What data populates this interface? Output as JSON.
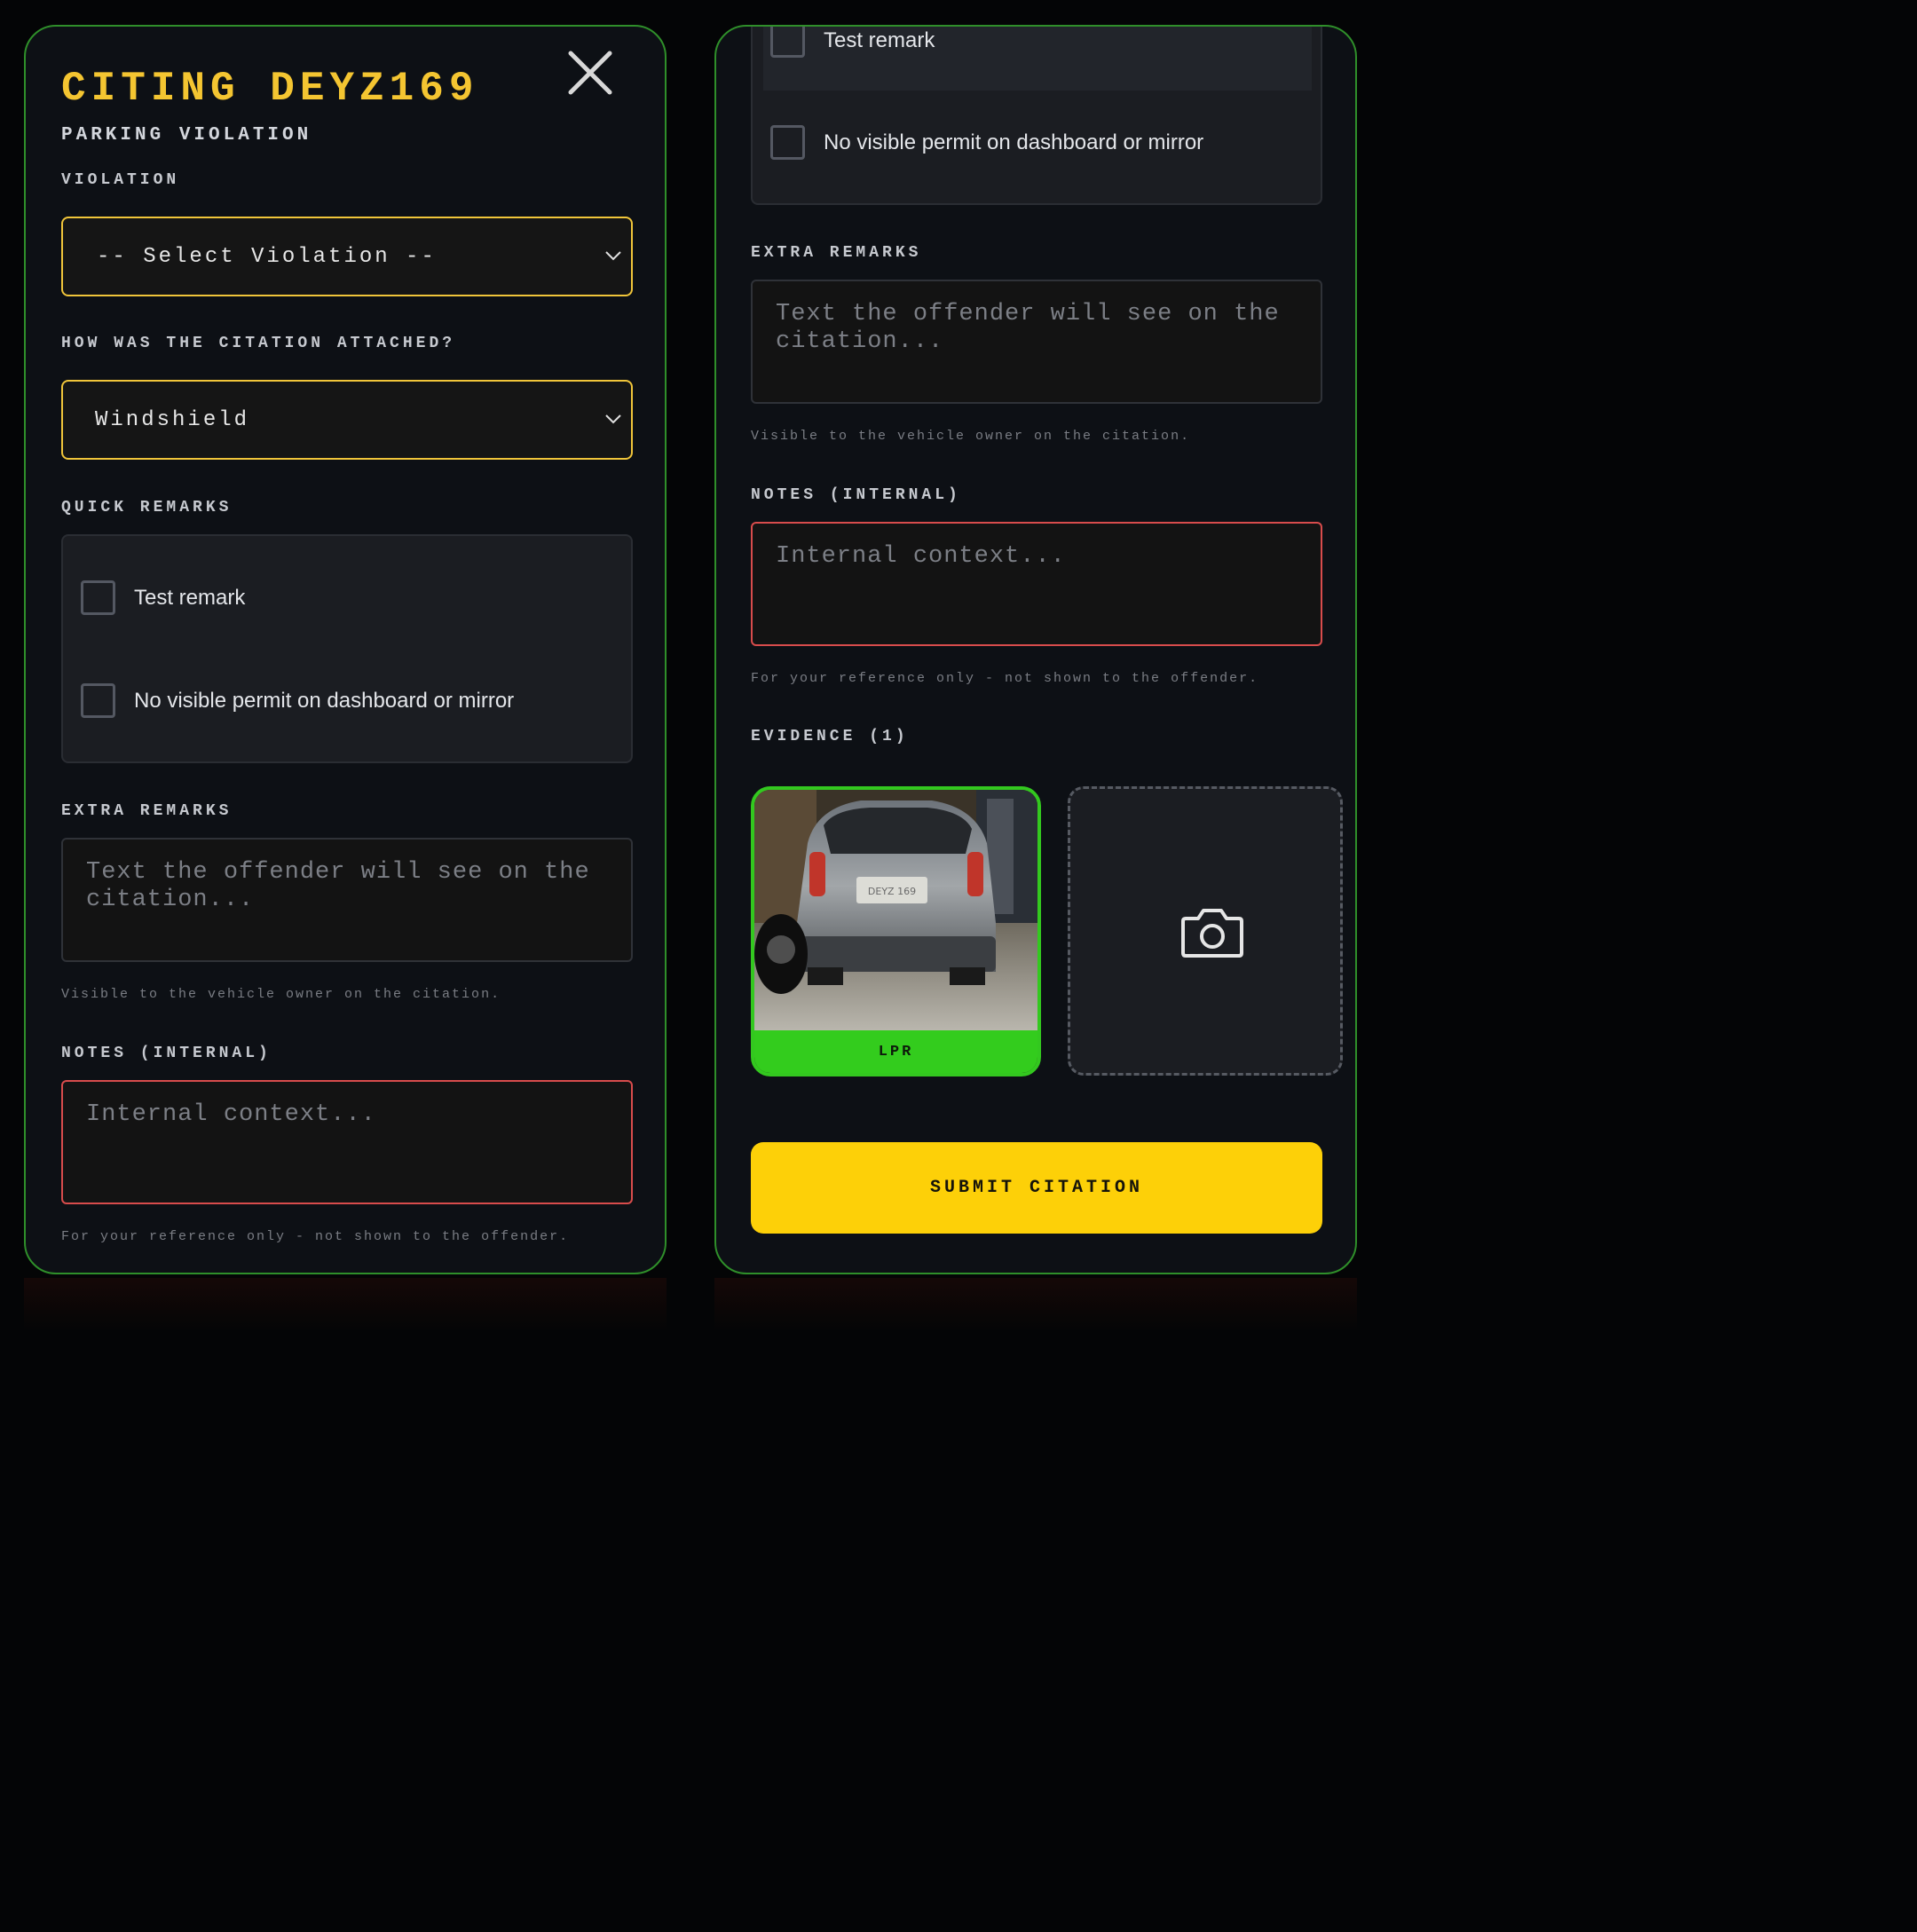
{
  "header": {
    "title": "CITING DEYZ169",
    "subtitle": "PARKING VIOLATION"
  },
  "violation": {
    "label": "VIOLATION",
    "selected": "-- Select Violation --"
  },
  "attachment": {
    "label": "HOW WAS THE CITATION ATTACHED?",
    "selected": "Windshield"
  },
  "quick_remarks": {
    "label": "QUICK REMARKS",
    "items": [
      {
        "text": "Test remark",
        "checked": false
      },
      {
        "text": "No visible permit on dashboard or mirror",
        "checked": false
      }
    ]
  },
  "extra_remarks": {
    "label": "EXTRA REMARKS",
    "placeholder": "Text the offender will see on the citation...",
    "hint": "Visible to the vehicle owner on the citation."
  },
  "notes": {
    "label": "NOTES (INTERNAL)",
    "placeholder": "Internal context...",
    "hint": "For your reference only - not shown to the offender."
  },
  "evidence": {
    "label": "EVIDENCE (1)",
    "items": [
      {
        "tag": "LPR",
        "plate_text": "DEYZ 169"
      }
    ],
    "add_icon": "camera-icon"
  },
  "submit": {
    "label": "SUBMIT CITATION"
  },
  "colors": {
    "accent_yellow": "#fdd008",
    "title_yellow": "#f4c531",
    "panel_border_green": "#2f8f2a",
    "evidence_green": "#33cc1d",
    "internal_red": "#d84c4c"
  }
}
